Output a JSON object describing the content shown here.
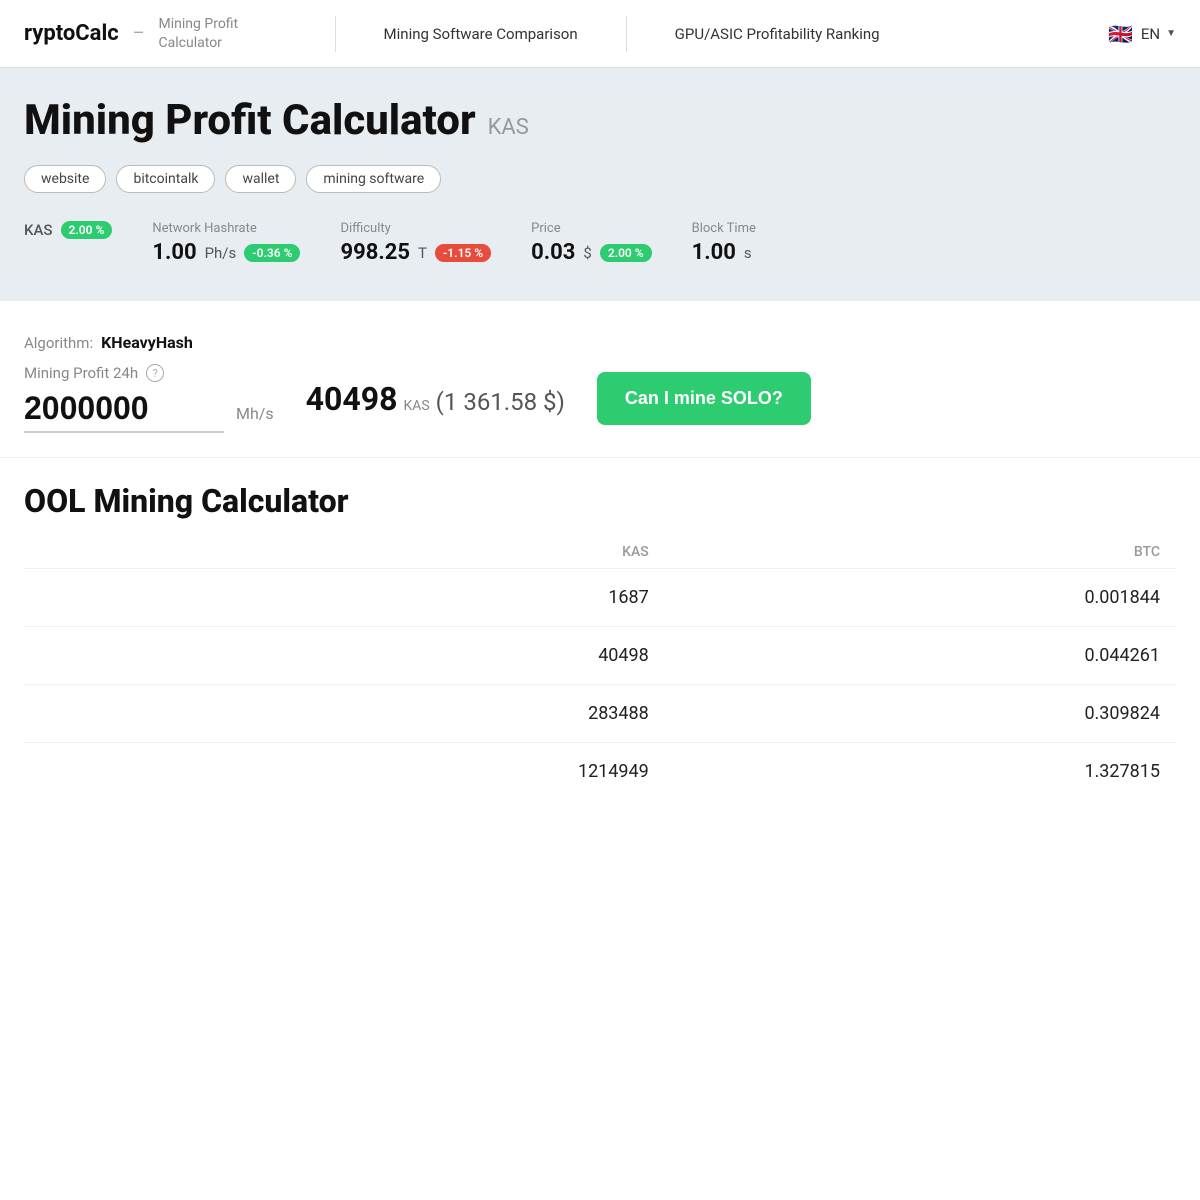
{
  "header": {
    "brand": "ryptoCalc",
    "separator": "–",
    "subtitle": "Mining Profit Calculator",
    "nav": [
      {
        "label": "Mining Software Comparison",
        "id": "nav-mining-software"
      },
      {
        "label": "GPU/ASIC Profitability Ranking",
        "id": "nav-gpu-ranking"
      }
    ],
    "lang": "EN",
    "flag": "🇬🇧"
  },
  "hero": {
    "title": "Mining Profit Calculator",
    "coin": "KAS",
    "tags": [
      {
        "label": "website",
        "id": "tag-website"
      },
      {
        "label": "bitcointalk",
        "id": "tag-bitcointalk"
      },
      {
        "label": "wallet",
        "id": "tag-wallet"
      },
      {
        "label": "mining software",
        "id": "tag-mining-software"
      }
    ],
    "stats": {
      "coin_label": "KAS",
      "coin_badge": "2.00 %",
      "coin_badge_color": "green",
      "network_hashrate": {
        "label": "Network Hashrate",
        "value": "1.00",
        "unit": "Ph/s",
        "badge": "-0.36 %",
        "badge_color": "green"
      },
      "difficulty": {
        "label": "Difficulty",
        "value": "998.25",
        "unit": "T",
        "badge": "-1.15 %",
        "badge_color": "red"
      },
      "price": {
        "label": "Price",
        "value": "0.03",
        "unit": "$",
        "badge": "2.00 %",
        "badge_color": "green"
      },
      "block_time": {
        "label": "Block Time",
        "value": "1.00",
        "unit": "s"
      }
    }
  },
  "calculator": {
    "algorithm_label": "Algorithm:",
    "algorithm_name": "KHeavyHash",
    "profit_label": "Mining Profit 24h",
    "hashrate_value": "2000000",
    "hashrate_unit": "Mh/s",
    "profit_kas": "40498",
    "profit_kas_unit": "KAS",
    "profit_usd": "(1 361.58 $)",
    "solo_button": "Can I mine SOLO?"
  },
  "pool_mining": {
    "title": "OOL Mining Calculator",
    "table": {
      "headers": [
        "",
        "KAS",
        "BTC"
      ],
      "rows": [
        {
          "period": "",
          "kas": "1687",
          "btc": "0.001844"
        },
        {
          "period": "",
          "kas": "40498",
          "btc": "0.044261"
        },
        {
          "period": "",
          "kas": "283488",
          "btc": "0.309824"
        },
        {
          "period": "",
          "kas": "1214949",
          "btc": "1.327815"
        }
      ]
    }
  }
}
